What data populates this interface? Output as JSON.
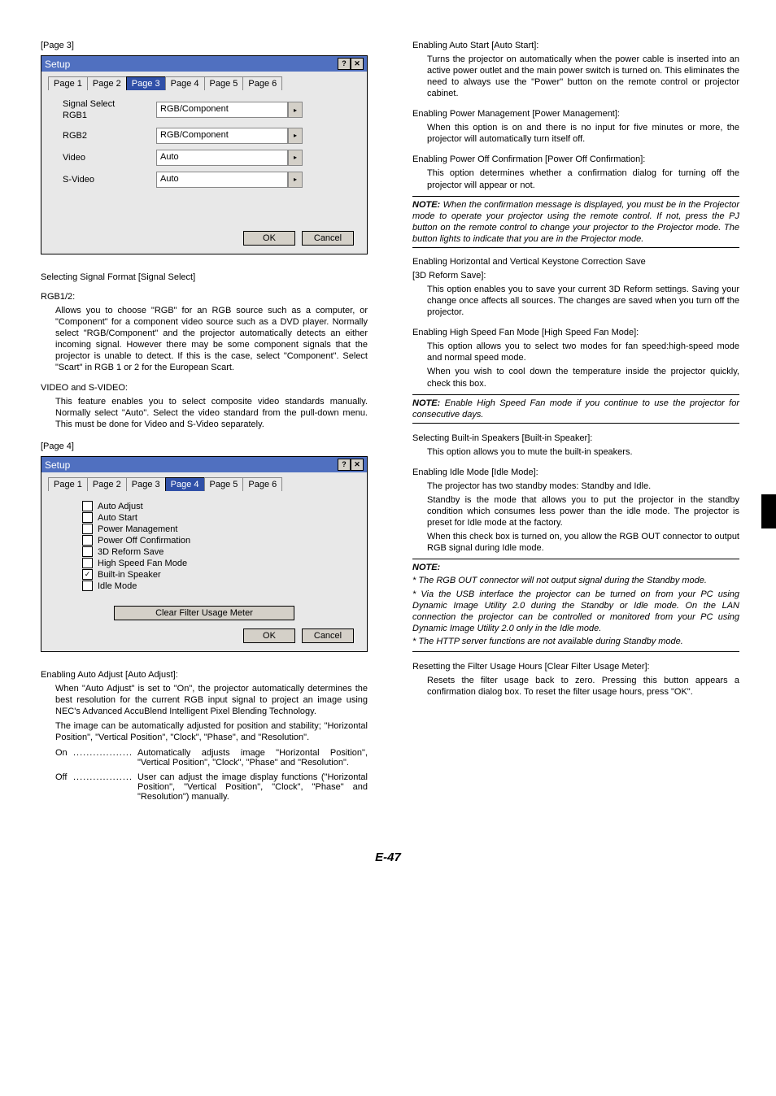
{
  "leftCol": {
    "page3Label": "[Page 3]",
    "dialogTitle": "Setup",
    "tabs": [
      "Page 1",
      "Page 2",
      "Page 3",
      "Page 4",
      "Page 5",
      "Page 6"
    ],
    "page3SelectedTabIndex": 2,
    "signalSelect": {
      "heading": "Signal Select",
      "rows": [
        {
          "label": "RGB1",
          "value": "RGB/Component"
        },
        {
          "label": "RGB2",
          "value": "RGB/Component"
        },
        {
          "label": "Video",
          "value": "Auto"
        },
        {
          "label": "S-Video",
          "value": "Auto"
        }
      ]
    },
    "ok": "OK",
    "cancel": "Cancel",
    "selectingHeading": "Selecting Signal Format [Signal Select]",
    "rgb12Label": "RGB1/2:",
    "rgb12Para": "Allows you to choose \"RGB\" for an RGB source such as a computer, or \"Component\" for a component video source such as a DVD player. Normally select \"RGB/Component\" and the projector automatically detects an either incoming signal. However there may be some component signals that the projector is unable to detect. If this is the case, select \"Component\". Select \"Scart\" in RGB 1 or 2 for the European Scart.",
    "videoSLabel": "VIDEO and S-VIDEO:",
    "videoSPara": "This feature enables you to select composite video standards manually. Normally select \"Auto\". Select the video standard from the pull-down menu. This must be done for Video and S-Video separately.",
    "page4Label": "[Page 4]",
    "page4SelectedTabIndex": 3,
    "checkItems": [
      {
        "label": "Auto Adjust",
        "checked": false
      },
      {
        "label": "Auto Start",
        "checked": false
      },
      {
        "label": "Power Management",
        "checked": false
      },
      {
        "label": "Power Off Confirmation",
        "checked": false
      },
      {
        "label": "3D Reform Save",
        "checked": false
      },
      {
        "label": "High Speed Fan Mode",
        "checked": false
      },
      {
        "label": "Built-in Speaker",
        "checked": true
      },
      {
        "label": "Idle Mode",
        "checked": false
      }
    ],
    "clearFilter": "Clear Filter Usage Meter",
    "autoAdjustHeading": "Enabling Auto Adjust [Auto Adjust]:",
    "autoAdjustPara1": "When \"Auto Adjust\" is set to \"On\", the projector automatically determines the best resolution for the current RGB input signal to project an image using NEC's Advanced AccuBlend Intelligent Pixel Blending Technology.",
    "autoAdjustPara2": "The image can be automatically adjusted for position and stability; \"Horizontal Position\", \"Vertical Position\", \"Clock\", \"Phase\", and \"Resolution\".",
    "onLabel": "On",
    "onDots": "..................",
    "onText": "Automatically adjusts image \"Horizontal Position\", \"Vertical Position\", \"Clock\", \"Phase\" and \"Resolution\".",
    "offLabel": "Off",
    "offDots": "..................",
    "offText": "User can adjust the image display functions (\"Horizontal Position\", \"Vertical Position\", \"Clock\", \"Phase\" and \"Resolution\") manually."
  },
  "rightCol": {
    "autoStartHeading": "Enabling Auto Start [Auto Start]:",
    "autoStartPara": "Turns the projector on automatically when the power cable is inserted into an active power outlet and the main power switch is turned on. This eliminates the need to always use the \"Power\" button on the remote control or projector cabinet.",
    "pmHeading": "Enabling Power Management [Power Management]:",
    "pmPara": "When this option is on and there is no input for five minutes or more, the projector will automatically turn itself off.",
    "pocHeading": "Enabling Power Off Confirmation [Power Off Confirmation]:",
    "pocPara": "This option determines whether a confirmation dialog for turning off the projector will appear or not.",
    "note1Head": "NOTE:",
    "note1Body": " When the confirmation message is displayed, you must be in the Projector mode to operate your projector using the remote control. If not, press the PJ button on the remote control to change your projector to the Projector mode. The button lights to indicate that you are in the Projector mode.",
    "hvkHeading": "Enabling Horizontal and Vertical Keystone Correction Save",
    "hvkSub": "[3D Reform Save]:",
    "hvkPara": "This option enables you to save your current 3D Reform settings. Saving your change once affects all sources. The changes are saved when you turn off the projector.",
    "fanHeading": "Enabling High Speed Fan Mode [High Speed Fan Mode]:",
    "fanPara1": "This option allows you to select two modes for fan speed:high-speed mode and normal speed mode.",
    "fanPara2": "When you wish to cool down the temperature inside the projector quickly, check this box.",
    "note2Head": "NOTE:",
    "note2Body": " Enable High Speed Fan mode if you continue to use the projector for consecutive days.",
    "speakerHeading": "Selecting Built-in Speakers [Built-in Speaker]:",
    "speakerPara": "This option allows you to mute the built-in speakers.",
    "idleHeading": "Enabling Idle Mode [Idle Mode]:",
    "idlePara1": "The projector has two standby modes: Standby and Idle.",
    "idlePara2": "Standby is the mode that allows you to put the projector in the standby condition which consumes less power than the idle mode. The projector is preset for Idle mode at the factory.",
    "idlePara3": "When this check box is turned on, you allow the RGB OUT connector to output RGB signal during Idle mode.",
    "note3Head": "NOTE:",
    "note3Items": [
      "* The RGB OUT connector will not output signal during the Standby mode.",
      "* Via the USB interface the projector can be turned on from your PC using Dynamic Image Utility 2.0 during the Standby or Idle mode. On the LAN connection the projector can be controlled or monitored from your PC using Dynamic Image Utility 2.0 only in the Idle mode.",
      "* The HTTP server functions are not available during Standby mode."
    ],
    "resetHeading": "Resetting the Filter Usage Hours [Clear Filter Usage Meter]:",
    "resetPara": "Resets the filter usage back to zero. Pressing this button appears a confirmation dialog box. To reset the filter usage hours, press \"OK\"."
  },
  "pageNumber": "E-47",
  "icons": {
    "help": "?",
    "close": "✕",
    "arrow": "▸",
    "check": "✓"
  }
}
